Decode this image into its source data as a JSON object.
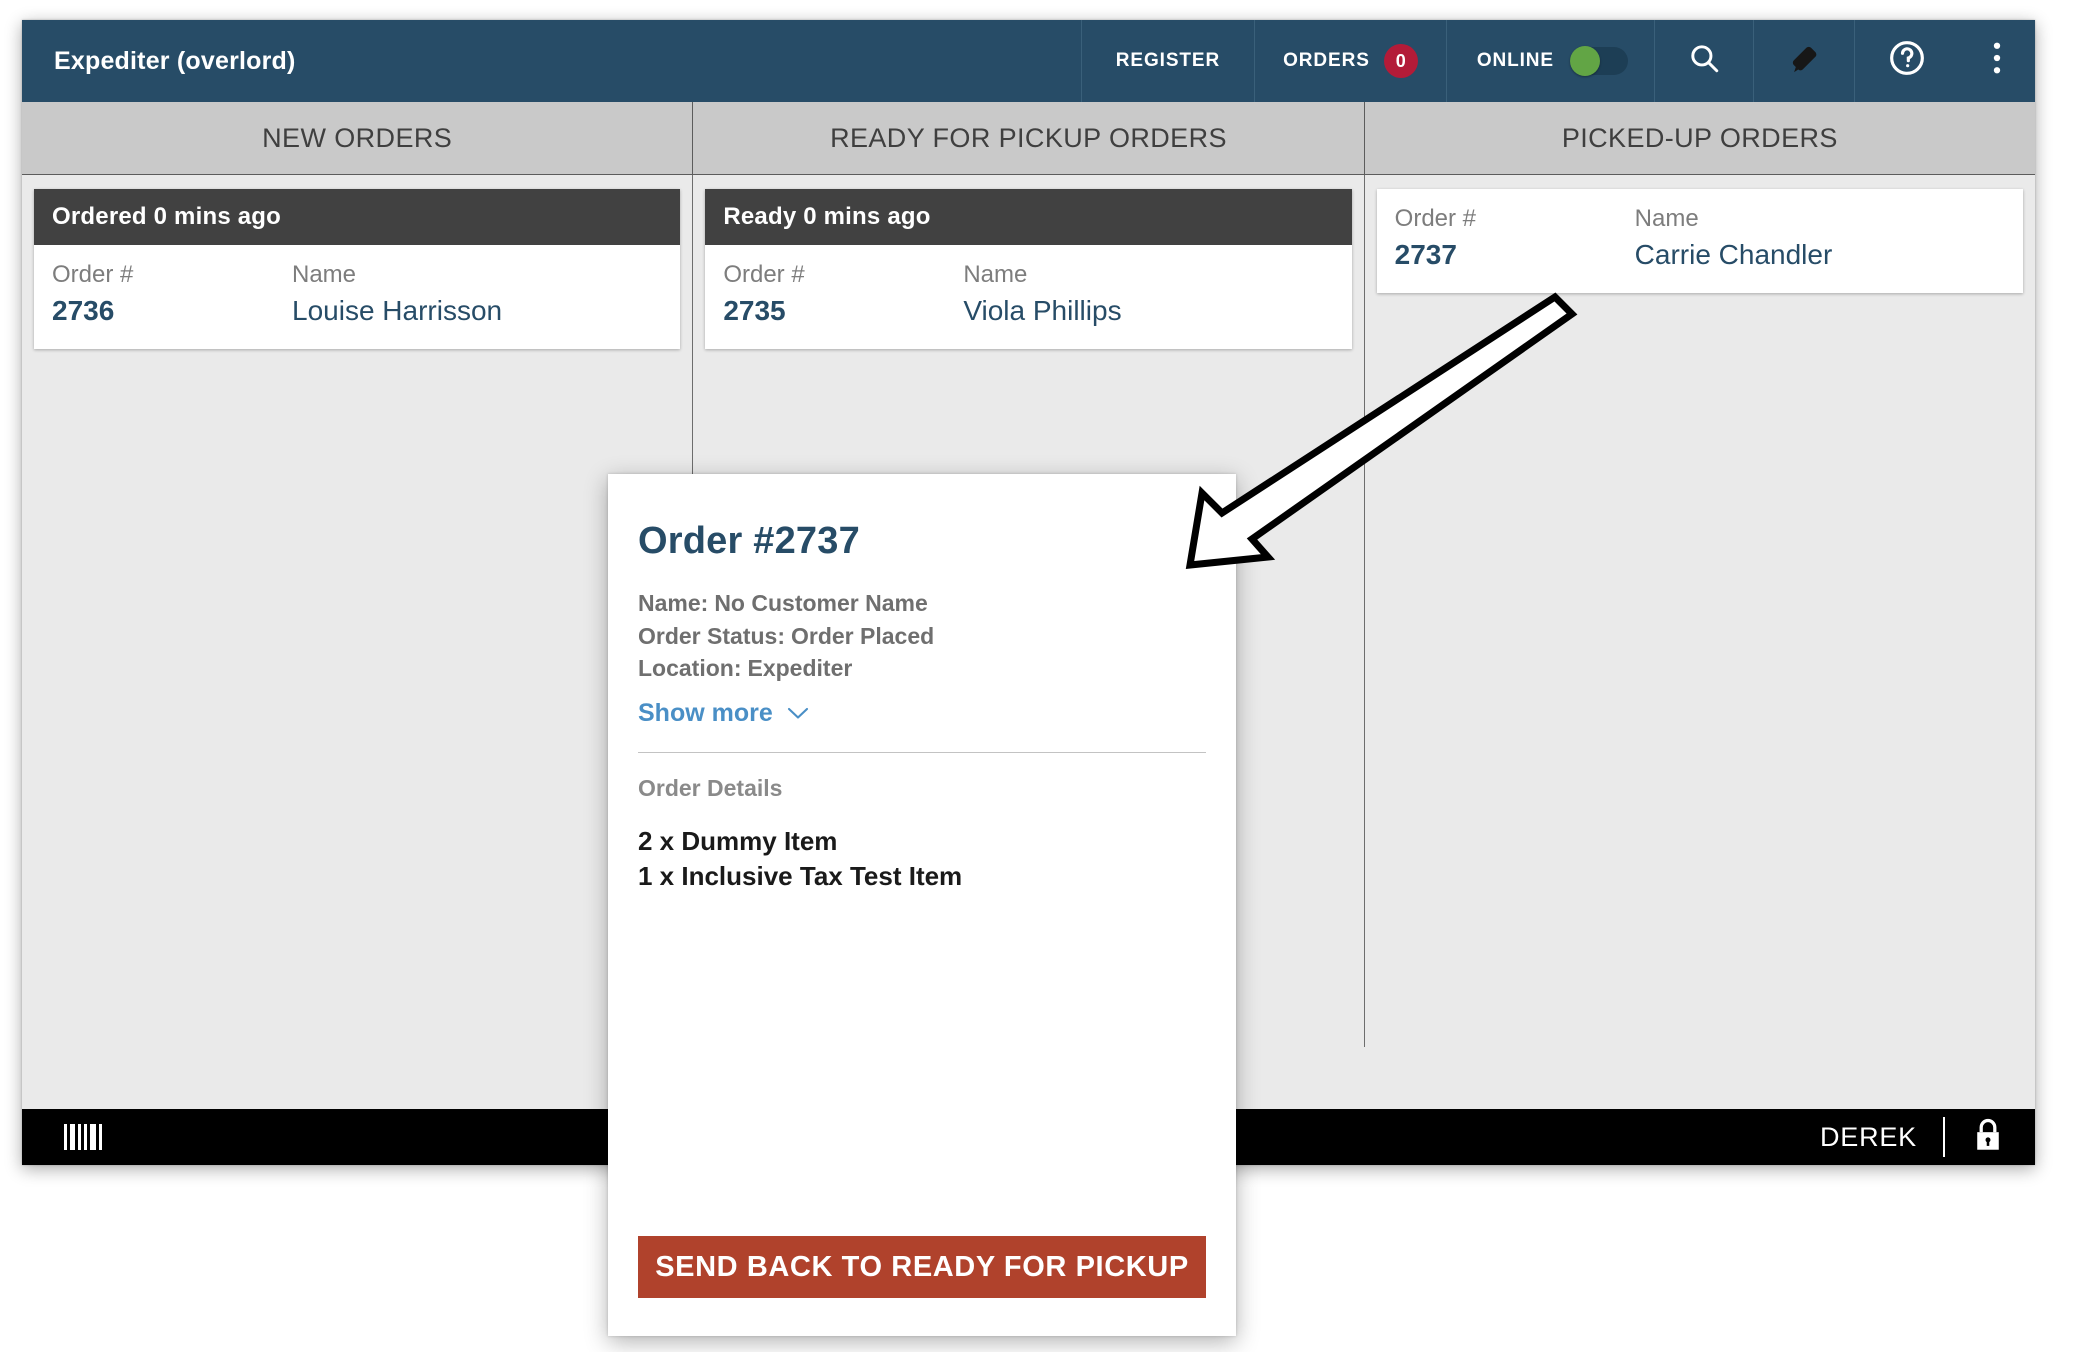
{
  "window": {
    "title": "Expediter (overlord)",
    "accent_blue": "#274c67",
    "badge_red": "#b31b38",
    "toggle_green": "#62a545",
    "danger_red": "#b0422c",
    "link_blue": "#4a8fc6"
  },
  "topbar": {
    "register_label": "REGISTER",
    "orders_label": "ORDERS",
    "orders_count": "0",
    "online_label": "ONLINE",
    "online_state": "on",
    "search_icon": "search-icon",
    "tag_icon": "tag-icon",
    "help_icon": "help-circle-icon",
    "more_icon": "more-vertical-icon"
  },
  "columns": [
    {
      "header": "NEW ORDERS",
      "cards": [
        {
          "time_label": "Ordered 0 mins ago",
          "order_label": "Order #",
          "order_value": "2736",
          "name_label": "Name",
          "name_value": "Louise Harrisson"
        }
      ]
    },
    {
      "header": "READY FOR PICKUP ORDERS",
      "cards": [
        {
          "time_label": "Ready 0 mins ago",
          "order_label": "Order #",
          "order_value": "2735",
          "name_label": "Name",
          "name_value": "Viola Phillips"
        }
      ]
    },
    {
      "header": "PICKED-UP ORDERS",
      "cards": [
        {
          "time_label": "",
          "order_label": "Order #",
          "order_value": "2737",
          "name_label": "Name",
          "name_value": "Carrie Chandler"
        }
      ]
    }
  ],
  "statusbar": {
    "barcode_icon": "barcode-icon",
    "user": "DEREK",
    "lock_icon": "lock-icon"
  },
  "modal": {
    "title": "Order #2737",
    "meta": [
      {
        "label": "Name:",
        "value": "No Customer Name"
      },
      {
        "label": "Order Status:",
        "value": "Order Placed"
      },
      {
        "label": "Location:",
        "value": "Expediter"
      }
    ],
    "show_more_label": "Show more",
    "show_more_icon": "chevron-down-icon",
    "details_label": "Order Details",
    "items": [
      "2 x Dummy Item",
      "1 x Inclusive Tax Test Item"
    ],
    "primary_button": "SEND BACK TO READY FOR PICKUP"
  },
  "annotation": {
    "arrow_icon": "arrow-pointer-icon",
    "direction": "down-left"
  }
}
